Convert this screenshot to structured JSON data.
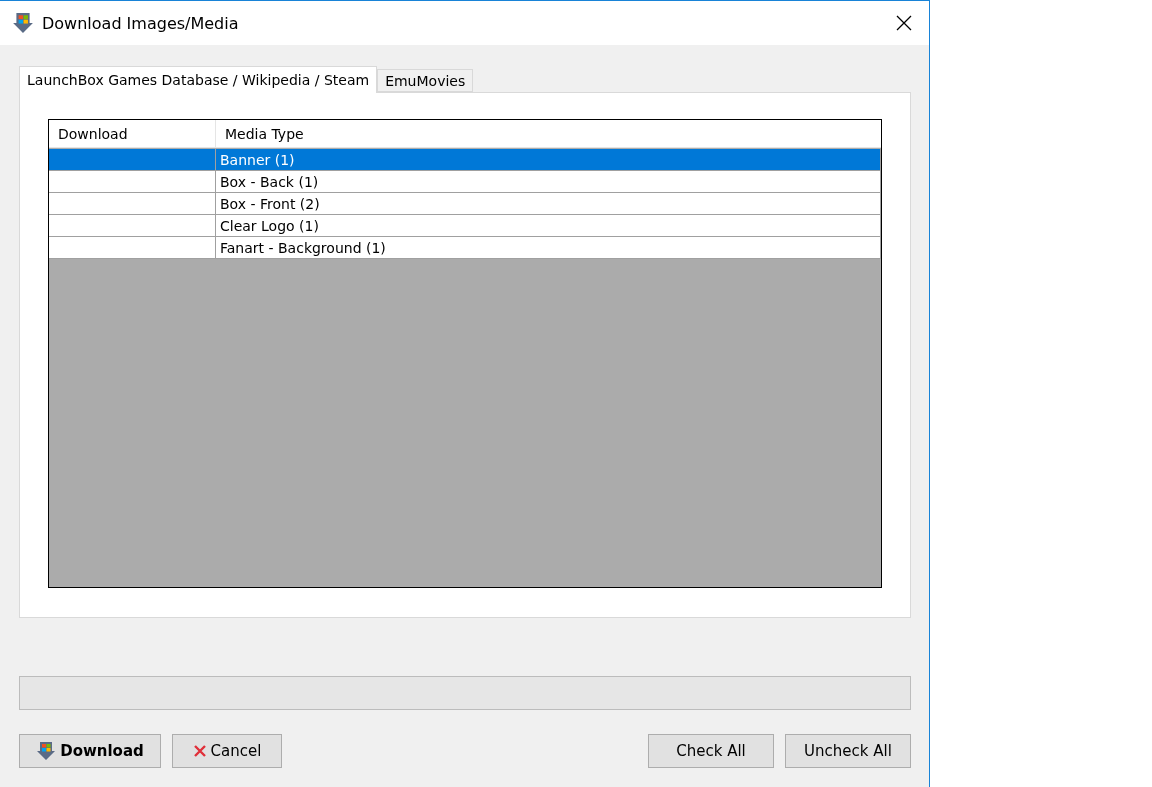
{
  "window": {
    "title": "Download Images/Media"
  },
  "tabs": [
    {
      "label": "LaunchBox Games Database / Wikipedia / Steam",
      "selected": true
    },
    {
      "label": "EmuMovies",
      "selected": false
    }
  ],
  "table": {
    "columns": [
      "Download",
      "Media Type"
    ],
    "rows": [
      {
        "media_type": "Banner (1)",
        "selected": true
      },
      {
        "media_type": "Box - Back (1)",
        "selected": false
      },
      {
        "media_type": "Box - Front (2)",
        "selected": false
      },
      {
        "media_type": "Clear Logo (1)",
        "selected": false
      },
      {
        "media_type": "Fanart - Background (1)",
        "selected": false
      }
    ]
  },
  "progress": {
    "level": 0
  },
  "buttons": [
    {
      "label": "Download",
      "kind": "download"
    },
    {
      "label": "Cancel",
      "kind": "cancel"
    },
    {
      "label": "Check All",
      "kind": "plain"
    },
    {
      "label": "Uncheck All",
      "kind": "plain"
    }
  ]
}
